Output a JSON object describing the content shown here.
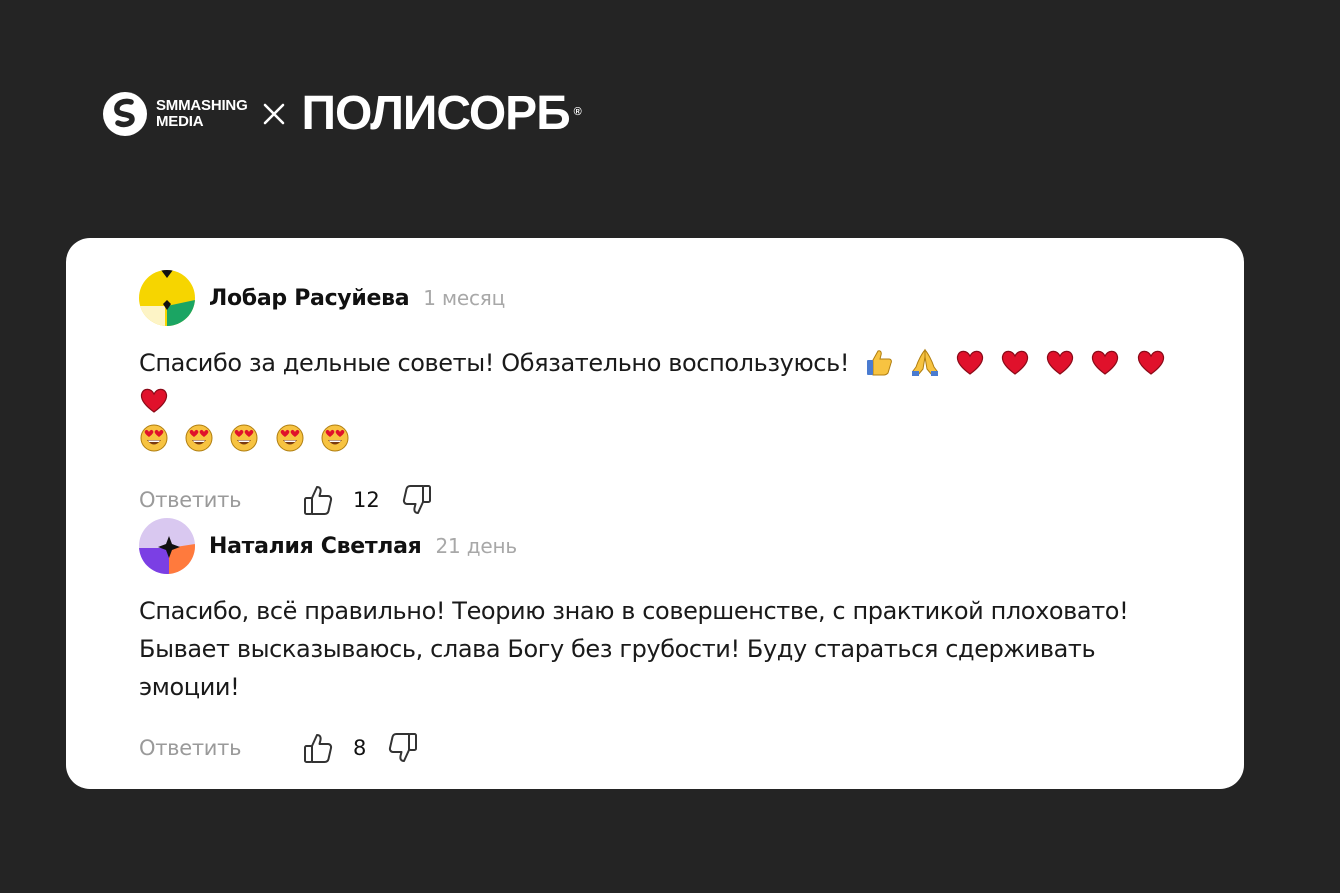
{
  "brand": {
    "smm_line1": "SMMASHING",
    "smm_line2": "MEDIA",
    "separator": "×",
    "partner": "ПОЛИСОРБ",
    "registered": "®"
  },
  "colors": {
    "background": "#242424",
    "card": "#ffffff",
    "heart": "#e0112b"
  },
  "comments": [
    {
      "author": "Лобар Расуйева",
      "time": "1 месяц",
      "text": "Спасибо за дельные советы! Обязательно воспользуюсь!",
      "emoji_line1": [
        "thumbs-up",
        "folded-hands",
        "heart",
        "heart",
        "heart",
        "heart",
        "heart",
        "heart"
      ],
      "emoji_line2": [
        "heart-eyes",
        "heart-eyes",
        "heart-eyes",
        "heart-eyes",
        "heart-eyes"
      ],
      "reply": "Ответить",
      "likes": "12"
    },
    {
      "author": "Наталия Светлая",
      "time": "21 день",
      "text": "Спасибо, всё правильно! Теорию знаю в совершенстве, с практикой плоховато! Бывает высказываюсь, слава Богу без грубости! Буду стараться сдерживать эмоции!",
      "reply": "Ответить",
      "likes": "8"
    }
  ]
}
